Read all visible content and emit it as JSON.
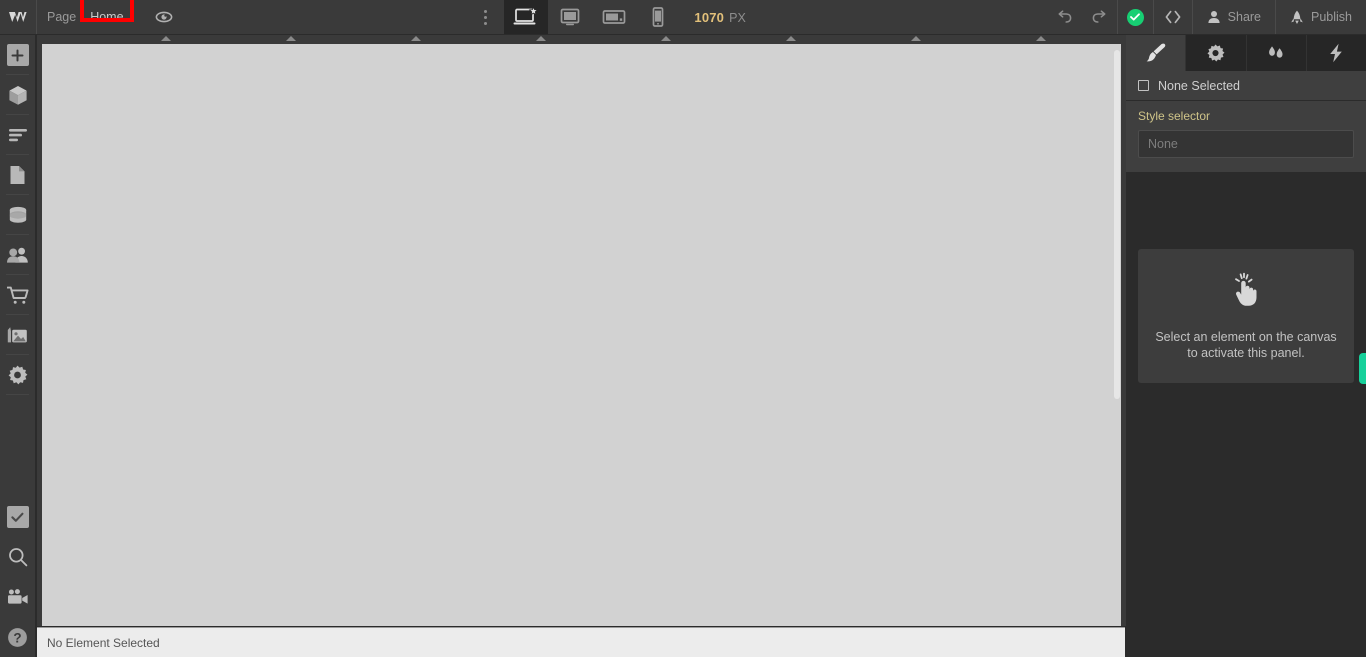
{
  "topbar": {
    "logo_icon": "webflow-w-logo",
    "page_label": "Page",
    "page_name": "Home",
    "page_name_highlighted": true,
    "highlight_color": "#ff0000",
    "preview_icon": "eye-icon",
    "kebab_icon": "more-vertical-icon",
    "devices": [
      {
        "name": "desktop",
        "icon": "desktop-star-icon",
        "active": true
      },
      {
        "name": "tablet",
        "icon": "tablet-icon",
        "active": false
      },
      {
        "name": "tablet-landscape",
        "icon": "tablet-landscape-icon",
        "active": false
      },
      {
        "name": "mobile",
        "icon": "mobile-icon",
        "active": false
      }
    ],
    "canvas_width_value": "1070",
    "canvas_width_unit": "PX",
    "undo_icon": "undo-arrow-icon",
    "redo_icon": "redo-arrow-icon",
    "status_icon": "green-check-icon",
    "status_color": "#17cf73",
    "code_icon": "code-brackets-icon",
    "share_icon": "person-icon",
    "share_label": "Share",
    "publish_icon": "rocket-icon",
    "publish_label": "Publish"
  },
  "sidebar": {
    "items": [
      {
        "name": "add-elements",
        "icon": "plus-icon"
      },
      {
        "name": "components",
        "icon": "cube-icon"
      },
      {
        "name": "navigator",
        "icon": "layers-lines-icon"
      },
      {
        "name": "pages",
        "icon": "page-document-icon"
      },
      {
        "name": "cms",
        "icon": "database-stack-icon"
      },
      {
        "name": "users",
        "icon": "people-icon"
      },
      {
        "name": "ecommerce",
        "icon": "shopping-cart-icon"
      },
      {
        "name": "assets",
        "icon": "image-stack-icon"
      },
      {
        "name": "settings",
        "icon": "gear-icon"
      }
    ],
    "bottom_items": [
      {
        "name": "audit",
        "icon": "checkbox-check-icon"
      },
      {
        "name": "search",
        "icon": "magnifier-icon"
      },
      {
        "name": "video",
        "icon": "video-camera-icon"
      },
      {
        "name": "help",
        "icon": "question-mark-icon"
      }
    ]
  },
  "canvas": {
    "background_color": "#d2d2d2",
    "ruler_tick_count": 9,
    "scrollbar_visible": true
  },
  "statusbar": {
    "text": "No Element Selected"
  },
  "right_panel": {
    "tabs": [
      {
        "name": "style",
        "icon": "paintbrush-icon",
        "active": true
      },
      {
        "name": "settings",
        "icon": "gear-icon",
        "active": false
      },
      {
        "name": "interactions",
        "icon": "droplets-icon",
        "active": false
      },
      {
        "name": "effects",
        "icon": "lightning-bolt-icon",
        "active": false
      }
    ],
    "selection_label": "None Selected",
    "selection_icon": "empty-square-icon",
    "style_selector_label": "Style selector",
    "style_selector_placeholder": "None",
    "empty_state": {
      "icon": "clicking-hand-icon",
      "line1": "Select an element on the canvas",
      "line2": "to activate this panel."
    },
    "side_tab_color": "#17d19b"
  }
}
